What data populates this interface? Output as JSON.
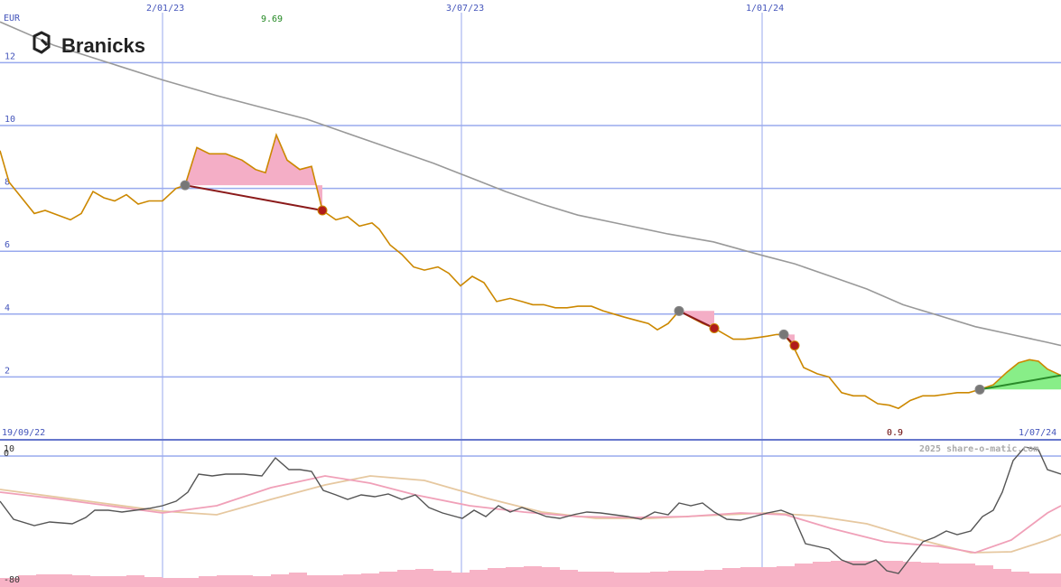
{
  "chart_data": {
    "type": "line",
    "currency": "EUR",
    "brand": "Branicks",
    "watermark": "2025 share-o-matic.com",
    "x_tick_labels_top": [
      "2/01/23",
      "3/07/23",
      "1/01/24"
    ],
    "x_tick_labels_bottom": [
      "19/09/22",
      "1/07/24"
    ],
    "y_ticks": [
      2,
      4,
      6,
      8,
      10,
      12
    ],
    "ylim": [
      0,
      14
    ],
    "max_label": "9.69",
    "min_label": "0.9",
    "oscillator_ticks": [
      "10",
      "0",
      "-80"
    ],
    "colors": {
      "price": "#cc8800",
      "moving_average": "#999999",
      "grid": "#99aaee",
      "gain_fill": "#88ee88",
      "loss_fill": "#f4aec6",
      "loss_line": "#8b1a1a",
      "gain_line": "#2a8a2a",
      "max_label": "#228822",
      "min_label": "#660000",
      "oscillator_main": "#555555",
      "oscillator_fast": "#f0a0b8",
      "oscillator_slow": "#e6c8a0"
    },
    "price_series": [
      [
        0,
        9.2
      ],
      [
        10,
        8.2
      ],
      [
        38,
        7.2
      ],
      [
        50,
        7.3
      ],
      [
        78,
        7.0
      ],
      [
        90,
        7.2
      ],
      [
        103,
        7.9
      ],
      [
        115,
        7.7
      ],
      [
        127,
        7.6
      ],
      [
        140,
        7.8
      ],
      [
        153,
        7.5
      ],
      [
        165,
        7.6
      ],
      [
        180,
        7.6
      ],
      [
        195,
        8.0
      ],
      [
        205,
        8.1
      ],
      [
        218,
        9.3
      ],
      [
        232,
        9.1
      ],
      [
        250,
        9.1
      ],
      [
        268,
        8.9
      ],
      [
        283,
        8.6
      ],
      [
        294,
        8.5
      ],
      [
        306,
        9.7
      ],
      [
        318,
        8.9
      ],
      [
        332,
        8.6
      ],
      [
        345,
        8.7
      ],
      [
        357,
        7.3
      ],
      [
        372,
        7.0
      ],
      [
        385,
        7.1
      ],
      [
        398,
        6.8
      ],
      [
        412,
        6.9
      ],
      [
        420,
        6.7
      ],
      [
        432,
        6.2
      ],
      [
        445,
        5.9
      ],
      [
        458,
        5.5
      ],
      [
        470,
        5.4
      ],
      [
        485,
        5.5
      ],
      [
        497,
        5.3
      ],
      [
        510,
        4.9
      ],
      [
        523,
        5.2
      ],
      [
        536,
        5.0
      ],
      [
        550,
        4.4
      ],
      [
        565,
        4.5
      ],
      [
        578,
        4.4
      ],
      [
        590,
        4.3
      ],
      [
        602,
        4.3
      ],
      [
        615,
        4.2
      ],
      [
        628,
        4.2
      ],
      [
        640,
        4.25
      ],
      [
        655,
        4.25
      ],
      [
        668,
        4.1
      ],
      [
        680,
        4.0
      ],
      [
        692,
        3.9
      ],
      [
        705,
        3.8
      ],
      [
        718,
        3.7
      ],
      [
        728,
        3.5
      ],
      [
        740,
        3.7
      ],
      [
        752,
        4.1
      ],
      [
        765,
        3.9
      ],
      [
        778,
        3.7
      ],
      [
        791,
        3.55
      ],
      [
        800,
        3.4
      ],
      [
        812,
        3.2
      ],
      [
        825,
        3.2
      ],
      [
        838,
        3.25
      ],
      [
        850,
        3.3
      ],
      [
        860,
        3.35
      ],
      [
        868,
        3.35
      ],
      [
        878,
        3.0
      ],
      [
        890,
        2.3
      ],
      [
        905,
        2.1
      ],
      [
        918,
        2.0
      ],
      [
        932,
        1.5
      ],
      [
        945,
        1.4
      ],
      [
        958,
        1.4
      ],
      [
        972,
        1.15
      ],
      [
        985,
        1.1
      ],
      [
        995,
        1.0
      ],
      [
        1008,
        1.25
      ],
      [
        1022,
        1.4
      ],
      [
        1035,
        1.4
      ],
      [
        1048,
        1.45
      ],
      [
        1060,
        1.5
      ],
      [
        1073,
        1.5
      ],
      [
        1085,
        1.6
      ],
      [
        1100,
        1.75
      ],
      [
        1115,
        2.15
      ],
      [
        1128,
        2.45
      ],
      [
        1140,
        2.55
      ],
      [
        1150,
        2.5
      ],
      [
        1160,
        2.25
      ],
      [
        1175,
        2.05
      ]
    ],
    "moving_average_series": [
      [
        0,
        13.3
      ],
      [
        60,
        12.55
      ],
      [
        120,
        12.0
      ],
      [
        180,
        11.45
      ],
      [
        240,
        10.95
      ],
      [
        300,
        10.5
      ],
      [
        340,
        10.2
      ],
      [
        380,
        9.8
      ],
      [
        430,
        9.3
      ],
      [
        480,
        8.8
      ],
      [
        520,
        8.35
      ],
      [
        560,
        7.9
      ],
      [
        600,
        7.5
      ],
      [
        640,
        7.15
      ],
      [
        690,
        6.85
      ],
      [
        740,
        6.55
      ],
      [
        790,
        6.3
      ],
      [
        840,
        5.9
      ],
      [
        880,
        5.6
      ],
      [
        920,
        5.2
      ],
      [
        960,
        4.8
      ],
      [
        1000,
        4.3
      ],
      [
        1040,
        3.95
      ],
      [
        1080,
        3.6
      ],
      [
        1120,
        3.35
      ],
      [
        1160,
        3.1
      ],
      [
        1175,
        3.0
      ]
    ],
    "signals": [
      {
        "type": "loss",
        "entry": [
          205,
          8.1
        ],
        "exit": [
          357,
          7.3
        ]
      },
      {
        "type": "loss",
        "entry": [
          752,
          4.1
        ],
        "exit": [
          791,
          3.55
        ]
      },
      {
        "type": "loss",
        "entry": [
          868,
          3.35
        ],
        "exit": [
          880,
          3.0
        ]
      },
      {
        "type": "gain",
        "entry": [
          1085,
          1.6
        ],
        "exit": [
          1175,
          2.05
        ]
      }
    ],
    "oscillator": {
      "main": [
        [
          0,
          555
        ],
        [
          15,
          575
        ],
        [
          38,
          582
        ],
        [
          55,
          578
        ],
        [
          80,
          580
        ],
        [
          95,
          573
        ],
        [
          105,
          565
        ],
        [
          120,
          565
        ],
        [
          135,
          567
        ],
        [
          150,
          565
        ],
        [
          165,
          563
        ],
        [
          180,
          560
        ],
        [
          195,
          555
        ],
        [
          208,
          545
        ],
        [
          220,
          525
        ],
        [
          235,
          527
        ],
        [
          250,
          525
        ],
        [
          270,
          525
        ],
        [
          290,
          527
        ],
        [
          305,
          507
        ],
        [
          320,
          520
        ],
        [
          332,
          520
        ],
        [
          345,
          522
        ],
        [
          358,
          543
        ],
        [
          372,
          548
        ],
        [
          385,
          553
        ],
        [
          400,
          548
        ],
        [
          415,
          550
        ],
        [
          430,
          547
        ],
        [
          445,
          553
        ],
        [
          460,
          548
        ],
        [
          475,
          562
        ],
        [
          490,
          568
        ],
        [
          512,
          574
        ],
        [
          525,
          565
        ],
        [
          538,
          572
        ],
        [
          552,
          560
        ],
        [
          565,
          567
        ],
        [
          578,
          562
        ],
        [
          592,
          567
        ],
        [
          605,
          572
        ],
        [
          620,
          574
        ],
        [
          635,
          570
        ],
        [
          650,
          567
        ],
        [
          665,
          568
        ],
        [
          680,
          570
        ],
        [
          695,
          572
        ],
        [
          710,
          575
        ],
        [
          725,
          567
        ],
        [
          740,
          570
        ],
        [
          752,
          557
        ],
        [
          765,
          560
        ],
        [
          778,
          557
        ],
        [
          791,
          567
        ],
        [
          805,
          575
        ],
        [
          820,
          576
        ],
        [
          835,
          572
        ],
        [
          850,
          568
        ],
        [
          865,
          565
        ],
        [
          878,
          570
        ],
        [
          892,
          602
        ],
        [
          905,
          605
        ],
        [
          918,
          608
        ],
        [
          932,
          620
        ],
        [
          945,
          625
        ],
        [
          958,
          625
        ],
        [
          970,
          620
        ],
        [
          982,
          632
        ],
        [
          995,
          635
        ],
        [
          1008,
          618
        ],
        [
          1022,
          600
        ],
        [
          1035,
          595
        ],
        [
          1048,
          588
        ],
        [
          1060,
          592
        ],
        [
          1075,
          588
        ],
        [
          1088,
          572
        ],
        [
          1100,
          565
        ],
        [
          1110,
          545
        ],
        [
          1122,
          510
        ],
        [
          1135,
          495
        ],
        [
          1150,
          498
        ],
        [
          1160,
          520
        ],
        [
          1175,
          525
        ]
      ],
      "fast": [
        [
          0,
          545
        ],
        [
          60,
          552
        ],
        [
          120,
          560
        ],
        [
          180,
          568
        ],
        [
          240,
          560
        ],
        [
          300,
          540
        ],
        [
          360,
          527
        ],
        [
          410,
          535
        ],
        [
          460,
          548
        ],
        [
          520,
          560
        ],
        [
          580,
          567
        ],
        [
          640,
          572
        ],
        [
          700,
          573
        ],
        [
          760,
          572
        ],
        [
          820,
          568
        ],
        [
          870,
          570
        ],
        [
          920,
          585
        ],
        [
          980,
          600
        ],
        [
          1040,
          605
        ],
        [
          1080,
          612
        ],
        [
          1120,
          598
        ],
        [
          1160,
          568
        ],
        [
          1175,
          560
        ]
      ],
      "slow": [
        [
          0,
          542
        ],
        [
          60,
          550
        ],
        [
          120,
          558
        ],
        [
          180,
          566
        ],
        [
          240,
          570
        ],
        [
          300,
          553
        ],
        [
          360,
          537
        ],
        [
          410,
          527
        ],
        [
          470,
          532
        ],
        [
          540,
          552
        ],
        [
          600,
          567
        ],
        [
          660,
          574
        ],
        [
          720,
          574
        ],
        [
          780,
          571
        ],
        [
          850,
          568
        ],
        [
          900,
          571
        ],
        [
          960,
          580
        ],
        [
          1020,
          598
        ],
        [
          1075,
          612
        ],
        [
          1120,
          611
        ],
        [
          1160,
          598
        ],
        [
          1175,
          592
        ]
      ],
      "histogram": [
        [
          0,
          640
        ],
        [
          20,
          637
        ],
        [
          40,
          636
        ],
        [
          60,
          636
        ],
        [
          80,
          637
        ],
        [
          100,
          638
        ],
        [
          120,
          638
        ],
        [
          140,
          637
        ],
        [
          160,
          639
        ],
        [
          180,
          640
        ],
        [
          200,
          640
        ],
        [
          220,
          638
        ],
        [
          240,
          637
        ],
        [
          260,
          637
        ],
        [
          280,
          638
        ],
        [
          300,
          636
        ],
        [
          320,
          634
        ],
        [
          340,
          637
        ],
        [
          360,
          637
        ],
        [
          380,
          636
        ],
        [
          400,
          635
        ],
        [
          420,
          633
        ],
        [
          440,
          631
        ],
        [
          460,
          630
        ],
        [
          480,
          632
        ],
        [
          500,
          634
        ],
        [
          520,
          631
        ],
        [
          540,
          629
        ],
        [
          560,
          628
        ],
        [
          580,
          627
        ],
        [
          600,
          628
        ],
        [
          620,
          631
        ],
        [
          640,
          633
        ],
        [
          660,
          633
        ],
        [
          680,
          634
        ],
        [
          700,
          634
        ],
        [
          720,
          633
        ],
        [
          740,
          632
        ],
        [
          760,
          632
        ],
        [
          780,
          631
        ],
        [
          800,
          629
        ],
        [
          820,
          628
        ],
        [
          840,
          628
        ],
        [
          860,
          627
        ],
        [
          880,
          624
        ],
        [
          900,
          622
        ],
        [
          920,
          621
        ],
        [
          940,
          621
        ],
        [
          960,
          621
        ],
        [
          980,
          621
        ],
        [
          1000,
          622
        ],
        [
          1020,
          623
        ],
        [
          1040,
          624
        ],
        [
          1060,
          624
        ],
        [
          1080,
          626
        ],
        [
          1100,
          630
        ],
        [
          1120,
          633
        ],
        [
          1140,
          635
        ],
        [
          1160,
          635
        ]
      ]
    }
  }
}
